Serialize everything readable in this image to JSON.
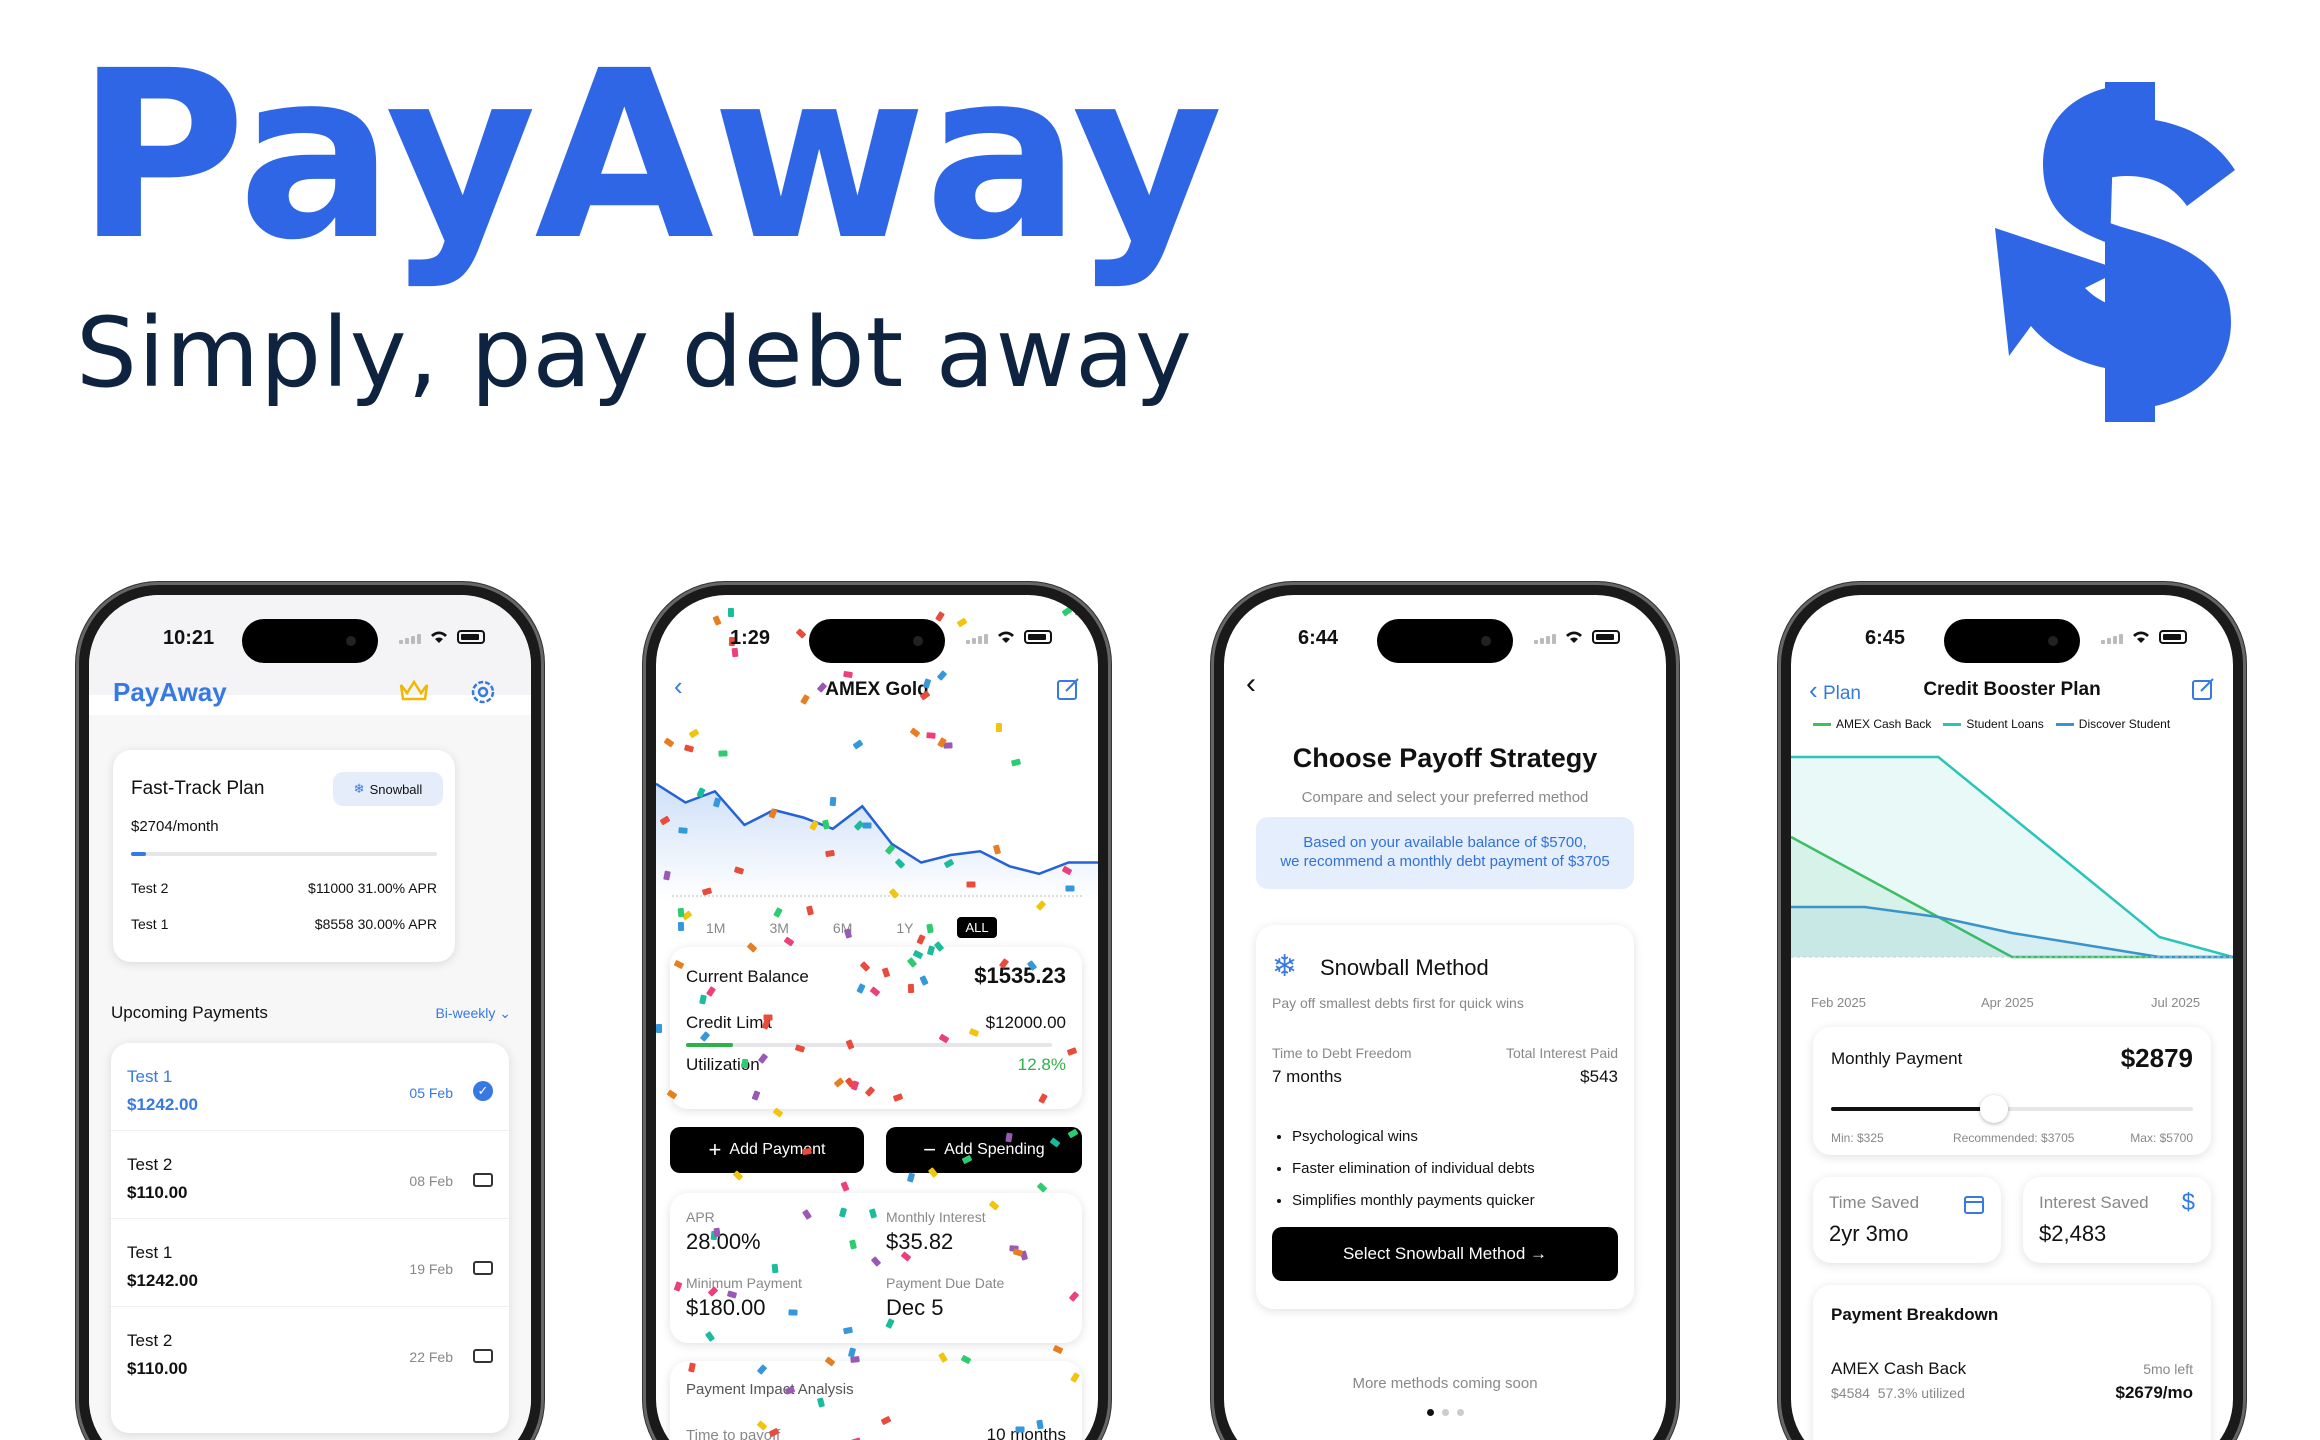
{
  "hero": {
    "title": "PayAway",
    "subtitle": "Simply, pay debt away",
    "logo_icon": "dollar-arrow-icon",
    "brand_color": "#2f66e6"
  },
  "phone1": {
    "time": "10:21",
    "app_title": "PayAway",
    "plan": {
      "name": "Fast-Track Plan",
      "badge": "Snowball",
      "monthly": "$2704/month",
      "progress": 0.05,
      "debts": [
        {
          "name": "Test 2",
          "amount": "$11000",
          "apr": "31.00% APR"
        },
        {
          "name": "Test 1",
          "amount": "$8558",
          "apr": "30.00% APR"
        }
      ]
    },
    "upcoming": {
      "title": "Upcoming Payments",
      "frequency": "Bi-weekly",
      "items": [
        {
          "name": "Test 1",
          "amount": "$1242.00",
          "date": "05 Feb",
          "done": true
        },
        {
          "name": "Test 2",
          "amount": "$110.00",
          "date": "08 Feb",
          "done": false
        },
        {
          "name": "Test 1",
          "amount": "$1242.00",
          "date": "19 Feb",
          "done": false
        },
        {
          "name": "Test 2",
          "amount": "$110.00",
          "date": "22 Feb",
          "done": false
        }
      ]
    }
  },
  "phone2": {
    "time": "1:29",
    "title": "AMEX Gold",
    "ranges": [
      "1M",
      "3M",
      "6M",
      "1Y",
      "ALL"
    ],
    "active_range": "ALL",
    "balance_label": "Current Balance",
    "balance": "$1535.23",
    "limit_label": "Credit Limit",
    "limit": "$12000.00",
    "util_label": "Utilization",
    "util": "12.8%",
    "util_fraction": 0.128,
    "add_payment": "Add Payment",
    "add_spending": "Add Spending",
    "apr_label": "APR",
    "apr": "28.00%",
    "interest_label": "Monthly Interest",
    "interest": "$35.82",
    "min_label": "Minimum Payment",
    "min": "$180.00",
    "due_label": "Payment Due Date",
    "due": "Dec 5",
    "impact_title": "Payment Impact Analysis",
    "payoff_label": "Time to payoff",
    "payoff": "10 months"
  },
  "phone3": {
    "time": "6:44",
    "title": "Choose Payoff Strategy",
    "subtitle": "Compare and select your preferred method",
    "reco_line1": "Based on your available balance of $5700,",
    "reco_line2": "we recommend a monthly debt payment of $3705",
    "method": "Snowball Method",
    "method_desc": "Pay off smallest debts first for quick wins",
    "freedom_label": "Time to Debt Freedom",
    "freedom": "7 months",
    "interest_label": "Total Interest Paid",
    "interest": "$543",
    "bullets": [
      "Psychological wins",
      "Faster elimination of individual debts",
      "Simplifies monthly payments quicker"
    ],
    "cta": "Select Snowball Method →",
    "more": "More methods coming soon"
  },
  "phone4": {
    "time": "6:45",
    "back": "Plan",
    "title": "Credit Booster Plan",
    "monthly_label": "Monthly Payment",
    "monthly": "$2879",
    "slider_fraction": 0.45,
    "min": "Min: $325",
    "recommended": "Recommended: $3705",
    "max": "Max: $5700",
    "saved_label": "Time Saved",
    "saved": "2yr 3mo",
    "isaved_label": "Interest Saved",
    "isaved": "$2,483",
    "breakdown_title": "Payment Breakdown",
    "breakdown": {
      "name": "AMEX Cash Back",
      "left": "5mo left",
      "detail": "$4584  57.3% utilized",
      "amount": "$2679/mo"
    }
  },
  "chart_data": [
    {
      "type": "line",
      "title": "",
      "xlabel": "",
      "ylabel": "",
      "series": [
        {
          "values": [
            62,
            52,
            58,
            40,
            48,
            44,
            38,
            50,
            30,
            20,
            24,
            26,
            18,
            14,
            20,
            20
          ]
        }
      ],
      "ylim": [
        0,
        80
      ],
      "grid": false
    },
    {
      "type": "area",
      "x_tick_labels": [
        "Feb 2025",
        "Apr 2025",
        "Jul 2025"
      ],
      "series": [
        {
          "name": "AMEX Cash Back",
          "color": "#3fbe5a",
          "values": [
            60,
            40,
            20,
            0,
            0,
            0,
            0
          ]
        },
        {
          "name": "Student Loans",
          "color": "#2bc4b8",
          "values": [
            100,
            100,
            100,
            70,
            40,
            10,
            0
          ]
        },
        {
          "name": "Discover Student",
          "color": "#3a93c9",
          "values": [
            25,
            25,
            20,
            12,
            6,
            0,
            0
          ]
        }
      ],
      "grid": false,
      "legend": "top"
    }
  ]
}
